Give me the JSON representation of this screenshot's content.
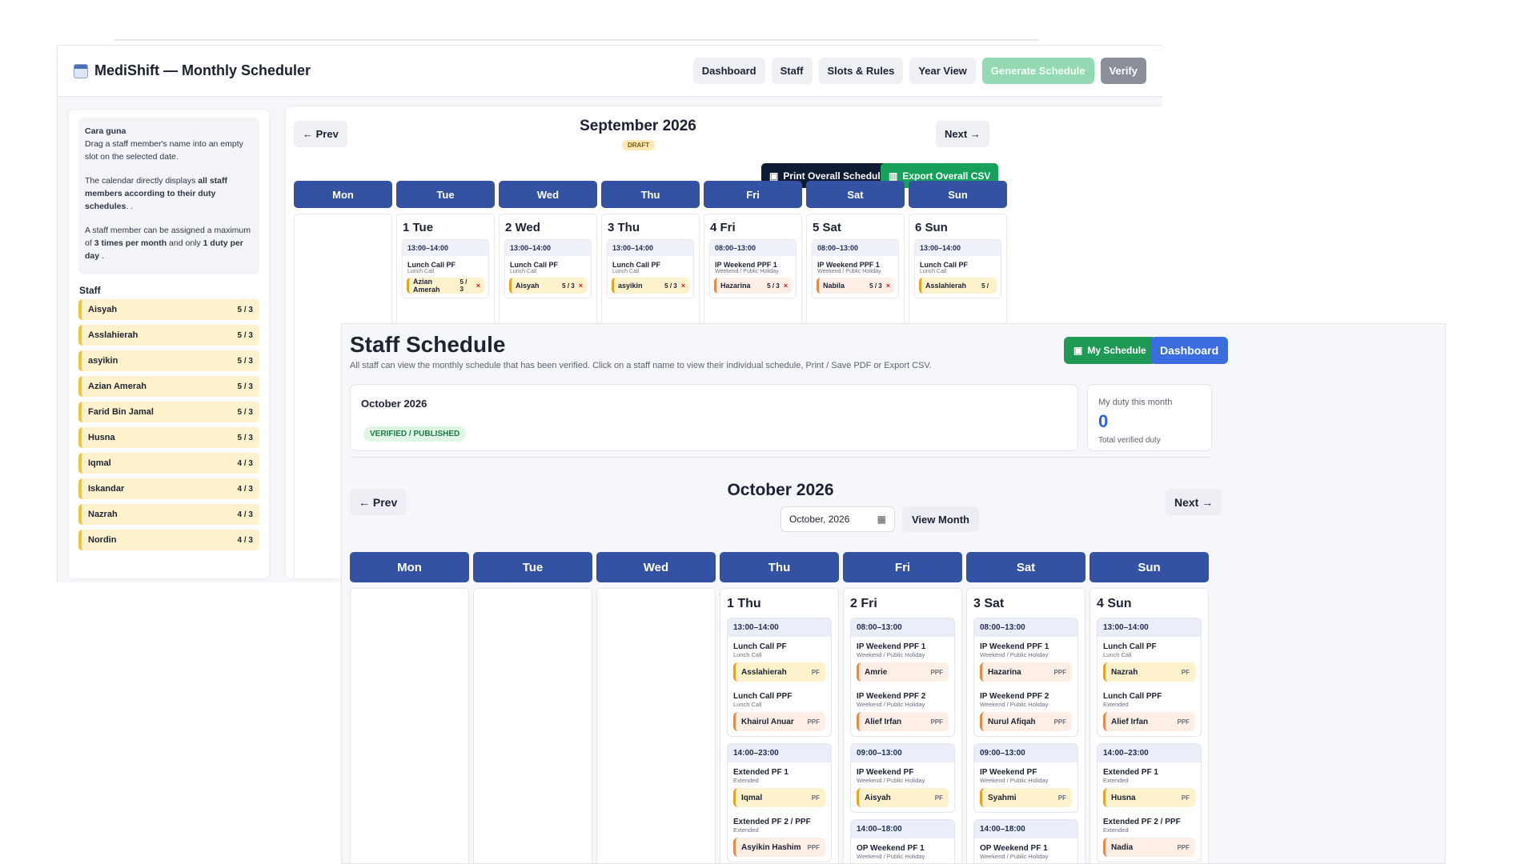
{
  "back": {
    "title": "MediShift — Monthly Scheduler",
    "nav": [
      "Dashboard",
      "Staff",
      "Slots & Rules",
      "Year View",
      "Generate Schedule",
      "Verify"
    ],
    "help_title": "Cara guna",
    "help_1": "Drag a staff member's name into an empty slot on the selected date.",
    "help_2a": "The calendar directly displays ",
    "help_2b": "all staff members according to their duty schedules",
    "help_2c": ". .",
    "help_3a": "A staff member can be assigned a maximum of ",
    "help_3b": "3 times per month",
    "help_3c": " and only ",
    "help_3d": "1 duty per day",
    "help_3e": " .",
    "staff_heading": "Staff",
    "staff": [
      {
        "name": "Aisyah",
        "count": "5 / 3"
      },
      {
        "name": "Asslahierah",
        "count": "5 / 3"
      },
      {
        "name": "asyikin",
        "count": "5 / 3"
      },
      {
        "name": "Azian Amerah",
        "count": "5 / 3"
      },
      {
        "name": "Farid Bin Jamal",
        "count": "5 / 3"
      },
      {
        "name": "Husna",
        "count": "5 / 3"
      },
      {
        "name": "Iqmal",
        "count": "4 / 3"
      },
      {
        "name": "Iskandar",
        "count": "4 / 3"
      },
      {
        "name": "Nazrah",
        "count": "4 / 3"
      },
      {
        "name": "Nordin",
        "count": "4 / 3"
      }
    ],
    "prev": "← Prev",
    "next": "Next →",
    "month": "September 2026",
    "status": "DRAFT",
    "print_btn": "Print Overall Schedule",
    "export_btn": "Export Overall CSV",
    "weekdays": [
      "Mon",
      "Tue",
      "Wed",
      "Thu",
      "Fri",
      "Sat",
      "Sun"
    ],
    "days": [
      {
        "label": "1 Tue",
        "time": "13:00–14:00",
        "slot": "Lunch Call PF",
        "sub": "Lunch Call",
        "staff": "Azian Amerah",
        "count": "5 / 3",
        "x": "×"
      },
      {
        "label": "2 Wed",
        "time": "13:00–14:00",
        "slot": "Lunch Call PF",
        "sub": "Lunch Call",
        "staff": "Aisyah",
        "count": "5 / 3",
        "x": "×"
      },
      {
        "label": "3 Thu",
        "time": "13:00–14:00",
        "slot": "Lunch Call PF",
        "sub": "Lunch Call",
        "staff": "asyikin",
        "count": "5 / 3",
        "x": "×"
      },
      {
        "label": "4 Fri",
        "time": "08:00–13:00",
        "slot": "IP Weekend PPF 1",
        "sub": "Weekend / Public Holiday",
        "staff": "Hazarina",
        "count": "5 / 3",
        "x": "×"
      },
      {
        "label": "5 Sat",
        "time": "08:00–13:00",
        "slot": "IP Weekend PPF 1",
        "sub": "Weekend / Public Holiday",
        "staff": "Nabila",
        "count": "5 / 3",
        "x": "×"
      },
      {
        "label": "6 Sun",
        "time": "13:00–14:00",
        "slot": "Lunch Call PF",
        "sub": "Lunch Call",
        "staff": "Asslahierah",
        "count": "5 /",
        "x": ""
      }
    ]
  },
  "front": {
    "title": "Staff Schedule",
    "subtitle": "All staff can view the monthly schedule that has been verified. Click on a staff name to view their individual schedule, Print / Save PDF or Export CSV.",
    "my_schedule": "My Schedule",
    "dashboard": "Dashboard",
    "info_month": "October 2026",
    "verified": "VERIFIED / PUBLISHED",
    "duty_label": "My duty this month",
    "duty_value": "0",
    "duty_caption": "Total verified duty",
    "prev": "← Prev",
    "next": "Next →",
    "month": "October 2026",
    "month_picker": "October, 2026",
    "view_month": "View Month",
    "weekdays": [
      "Mon",
      "Tue",
      "Wed",
      "Thu",
      "Fri",
      "Sat",
      "Sun"
    ],
    "days": [
      {
        "label": "1 Thu",
        "blocks": [
          {
            "time": "13:00–14:00",
            "entries": [
              {
                "slot": "Lunch Call PF",
                "sub": "Lunch Call",
                "staff": "Asslahierah",
                "role": "PF",
                "kind": "pf"
              },
              {
                "slot": "Lunch Call PPF",
                "sub": "Lunch Call",
                "staff": "Khairul Anuar",
                "role": "PPF",
                "kind": "ppf"
              }
            ]
          },
          {
            "time": "14:00–23:00",
            "entries": [
              {
                "slot": "Extended PF 1",
                "sub": "Extended",
                "staff": "Iqmal",
                "role": "PF",
                "kind": "pf"
              },
              {
                "slot": "Extended PF 2 / PPF",
                "sub": "Extended",
                "staff": "Asyikin Hashim",
                "role": "PPF",
                "kind": "ppf"
              }
            ]
          }
        ]
      },
      {
        "label": "2 Fri",
        "blocks": [
          {
            "time": "08:00–13:00",
            "entries": [
              {
                "slot": "IP Weekend PPF 1",
                "sub": "Weekend / Public Holiday",
                "staff": "Amrie",
                "role": "PPF",
                "kind": "ppf"
              },
              {
                "slot": "IP Weekend PPF 2",
                "sub": "Weekend / Public Holiday",
                "staff": "Alief Irfan",
                "role": "PPF",
                "kind": "ppf"
              }
            ]
          },
          {
            "time": "09:00–13:00",
            "entries": [
              {
                "slot": "IP Weekend PF",
                "sub": "Weekend / Public Holiday",
                "staff": "Aisyah",
                "role": "PF",
                "kind": "pf"
              }
            ]
          },
          {
            "time": "14:00–18:00",
            "entries": [
              {
                "slot": "OP Weekend PF 1",
                "sub": "Weekend / Public Holiday",
                "staff": "",
                "role": "",
                "kind": "pf"
              }
            ]
          }
        ]
      },
      {
        "label": "3 Sat",
        "blocks": [
          {
            "time": "08:00–13:00",
            "entries": [
              {
                "slot": "IP Weekend PPF 1",
                "sub": "Weekend / Public Holiday",
                "staff": "Hazarina",
                "role": "PPF",
                "kind": "ppf"
              },
              {
                "slot": "IP Weekend PPF 2",
                "sub": "Weekend / Public Holiday",
                "staff": "Nurul Afiqah",
                "role": "PPF",
                "kind": "ppf"
              }
            ]
          },
          {
            "time": "09:00–13:00",
            "entries": [
              {
                "slot": "IP Weekend PF",
                "sub": "Weekend / Public Holiday",
                "staff": "Syahmi",
                "role": "PF",
                "kind": "pf"
              }
            ]
          },
          {
            "time": "14:00–18:00",
            "entries": [
              {
                "slot": "OP Weekend PF 1",
                "sub": "Weekend / Public Holiday",
                "staff": "",
                "role": "",
                "kind": "pf"
              }
            ]
          }
        ]
      },
      {
        "label": "4 Sun",
        "blocks": [
          {
            "time": "13:00–14:00",
            "entries": [
              {
                "slot": "Lunch Call PF",
                "sub": "Lunch Call",
                "staff": "Nazrah",
                "role": "PF",
                "kind": "pf"
              },
              {
                "slot": "Lunch Call PPF",
                "sub": "Extended",
                "staff": "Alief Irfan",
                "role": "PPF",
                "kind": "ppf"
              }
            ]
          },
          {
            "time": "14:00–23:00",
            "entries": [
              {
                "slot": "Extended PF 1",
                "sub": "Extended",
                "staff": "Husna",
                "role": "PF",
                "kind": "pf"
              },
              {
                "slot": "Extended PF 2 / PPF",
                "sub": "Extended",
                "staff": "Nadia",
                "role": "PPF",
                "kind": "ppf"
              }
            ]
          }
        ]
      }
    ]
  }
}
